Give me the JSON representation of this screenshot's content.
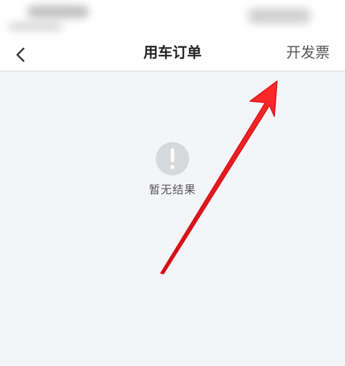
{
  "nav": {
    "title": "用车订单",
    "back_icon": "chevron-left-icon",
    "action_label": "开发票"
  },
  "empty_state": {
    "icon": "exclamation-circle-icon",
    "message": "暂无结果"
  },
  "colors": {
    "background": "#f4f5f8",
    "nav_background": "#ffffff",
    "empty_icon": "#d7d8da",
    "annotation_arrow": "#e8161b"
  }
}
